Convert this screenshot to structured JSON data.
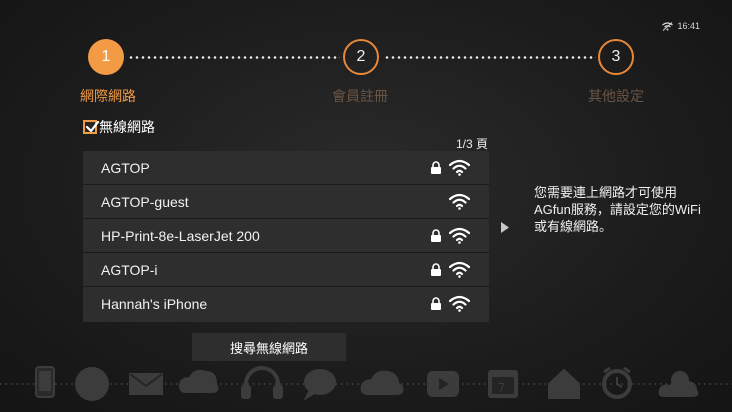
{
  "status": {
    "time": "16:41",
    "icon": "wifi-off-icon"
  },
  "steps": [
    {
      "number": "1",
      "label": "網際網路",
      "active": true
    },
    {
      "number": "2",
      "label": "會員註冊",
      "active": false
    },
    {
      "number": "3",
      "label": "其他設定",
      "active": false
    }
  ],
  "wireless_toggle": {
    "label": "無線網路",
    "checked": true
  },
  "page_indicator": "1/3 頁",
  "networks": [
    {
      "ssid": "AGTOP",
      "secured": true
    },
    {
      "ssid": "AGTOP-guest",
      "secured": false
    },
    {
      "ssid": "HP-Print-8e-LaserJet 200",
      "secured": true
    },
    {
      "ssid": "AGTOP-i",
      "secured": true
    },
    {
      "ssid": "Hannah's iPhone",
      "secured": true
    }
  ],
  "scan_button": "搜尋無線網路",
  "info_text": "您需要連上網路才可使用AGfun服務，請設定您的WiFi或有線網路。",
  "colors": {
    "accent": "#f39a44",
    "panel": "#2e2e2e",
    "background": "#1c1c1c"
  },
  "dock_icons": [
    "phone-icon",
    "globe-icon",
    "mail-icon",
    "cloud-sync-icon",
    "headphones-icon",
    "chat-icon",
    "cloud-icon",
    "video-icon",
    "calendar-icon",
    "home-icon",
    "alarm-clock-icon",
    "weather-icon"
  ]
}
